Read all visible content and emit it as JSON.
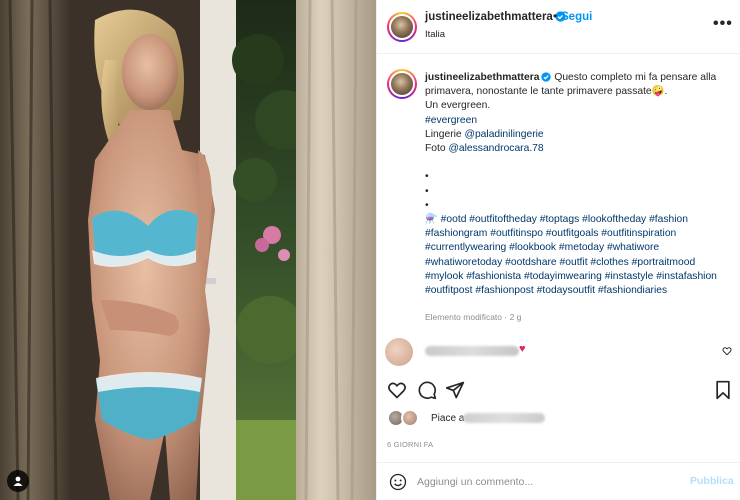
{
  "post": {
    "username": "justineelizabethmattera",
    "dot": "•",
    "follow_label": "Segui",
    "location": "Italia",
    "more_label": "•••",
    "caption": {
      "username": "justineelizabethmattera",
      "line1": " Questo completo mi fa pensare alla primavera, nonostante le tante primavere passate🤪.",
      "line2": "Un evergreen.",
      "line3": "#evergreen",
      "line4_prefix": "Lingerie ",
      "line4_link": "@paladinilingerie",
      "line5_prefix": "Foto ",
      "line5_link": "@alessandrocara.78",
      "bullet1": "•",
      "bullet2": "•",
      "bullet3": "•",
      "hashtags": "⚗️ #ootd #outfitoftheday #toptags #lookoftheday #fashion #fashiongram #outfitinspo #outfitgoals #outfitinspiration #currentlywearing #lookbook #metoday #whatiwore #whatiworetoday #ootdshare #outfit #clothes #portraitmood #mylook #fashionista #todayimwearing #instastyle #instafashion #outfitpost #fashionpost #todaysoutfit #fashiondiaries",
      "meta": "Elemento modificato · 2 g"
    },
    "comment": {
      "emoji": "♥"
    },
    "likes": {
      "prefix": "Piace a "
    },
    "timestamp": "6 GIORNI FA",
    "comment_box": {
      "placeholder": "Aggiungi un commento...",
      "publish_label": "Pubblica"
    }
  },
  "icons": {
    "user_tag": "user-tag-icon",
    "verified": "verified-badge-icon",
    "like": "heart-icon",
    "comment": "comment-icon",
    "share": "paper-plane-icon",
    "save": "bookmark-icon",
    "emoji": "smiley-icon"
  },
  "colors": {
    "accent": "#0095f6",
    "link": "#00376b",
    "muted": "#8e8e8e",
    "publish_disabled": "#b2dffc",
    "heart_red": "#e0245e"
  }
}
